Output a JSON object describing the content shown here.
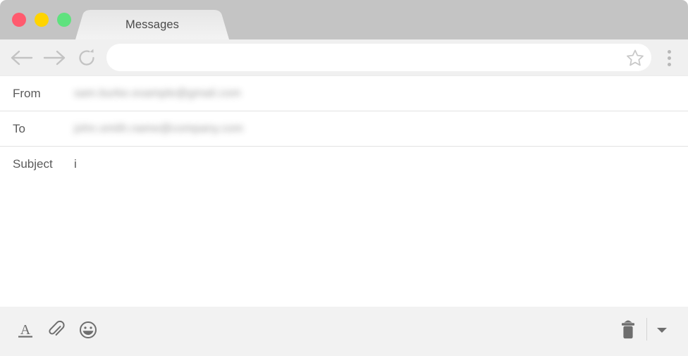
{
  "window": {
    "controls": [
      {
        "name": "close",
        "color": "#ff5a6e"
      },
      {
        "name": "minimize",
        "color": "#ffd400"
      },
      {
        "name": "maximize",
        "color": "#5fe27e"
      }
    ]
  },
  "tab": {
    "title": "Messages"
  },
  "navbar": {
    "back_label": "Back",
    "forward_label": "Forward",
    "reload_label": "Reload",
    "address_value": "",
    "address_placeholder": "",
    "bookmark_label": "Bookmark",
    "menu_label": "Menu"
  },
  "compose": {
    "fields": [
      {
        "label": "From",
        "value": "sam.burke.example@gmail.com",
        "redacted": true
      },
      {
        "label": "To",
        "value": "john.smith.name@company.com",
        "redacted": true
      },
      {
        "label": "Subject",
        "value": "i",
        "redacted": false
      }
    ],
    "body_value": ""
  },
  "toolbar": {
    "format_label": "Formatting options",
    "attach_label": "Attach file",
    "emoji_label": "Insert emoji",
    "delete_label": "Delete draft",
    "more_label": "More options"
  },
  "colors": {
    "titlebar": "#c4c4c4",
    "navbar": "#f0f0f0",
    "toolbar": "#f2f2f2",
    "tab_active": "#ededed",
    "text": "#5a5a5a",
    "icon": "#6e6e6e",
    "icon_light": "#c3c3c3",
    "divider": "#e2e2e2"
  }
}
